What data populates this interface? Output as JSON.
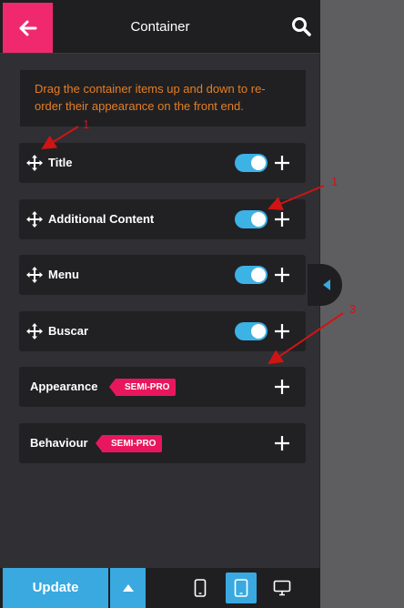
{
  "header": {
    "title": "Container",
    "back_icon": "arrow-left-icon",
    "search_icon": "search-icon",
    "accent": "#f0296e"
  },
  "info": {
    "text": "Drag the container items up and down to re-order their appearance on the front end."
  },
  "items": [
    {
      "label": "Title",
      "toggle": true
    },
    {
      "label": "Additional Content",
      "toggle": true
    },
    {
      "label": "Menu",
      "toggle": true
    },
    {
      "label": "Buscar",
      "toggle": true
    }
  ],
  "sections": [
    {
      "label": "Appearance",
      "badge": "SEMI-PRO"
    },
    {
      "label": "Behaviour",
      "badge": "SEMI-PRO"
    }
  ],
  "footer": {
    "update_label": "Update",
    "devices": [
      "mobile-icon",
      "tablet-icon",
      "desktop-icon"
    ],
    "active_device": "tablet-icon",
    "accent": "#39a9e0"
  },
  "annotations": [
    "1",
    "1",
    "3"
  ],
  "colors": {
    "toggle_on": "#3db2e5",
    "badge": "#e8175d",
    "info_text": "#e67e22",
    "annotation": "#d01414"
  }
}
